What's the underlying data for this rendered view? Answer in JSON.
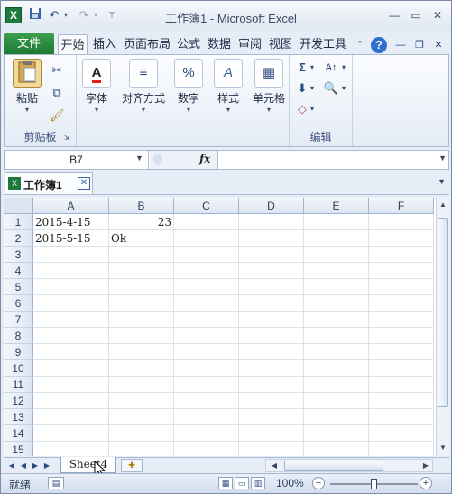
{
  "app": {
    "title": "工作簿1  -  Microsoft Excel",
    "icon_text": "X"
  },
  "qat": {
    "save_icon": "save-icon",
    "undo_icon": "undo-icon",
    "redo_icon": "redo-icon"
  },
  "ribbon_tabs": {
    "file": "文件",
    "items": [
      "开始",
      "插入",
      "页面布局",
      "公式",
      "数据",
      "审阅",
      "视图",
      "开发工具"
    ],
    "active": "开始"
  },
  "ribbon": {
    "paste_label": "粘贴",
    "clipboard_group": "剪贴板",
    "font_label": "字体",
    "align_label": "对齐方式",
    "number_label": "数字",
    "number_symbol": "%",
    "styles_label": "样式",
    "cells_label": "单元格",
    "editing_group": "编辑",
    "sigma_symbol": "Σ"
  },
  "formula_bar": {
    "name_box": "B7",
    "fx": "fx",
    "content": ""
  },
  "workbook_tab": {
    "name": "工作簿1",
    "close": "✕"
  },
  "grid": {
    "columns": [
      "A",
      "B",
      "C",
      "D",
      "E",
      "F"
    ],
    "rows": [
      "1",
      "2",
      "3",
      "4",
      "5",
      "6",
      "7",
      "8",
      "9",
      "10",
      "11",
      "12",
      "13",
      "14",
      "15"
    ],
    "cells": {
      "A1": "2015-4-15",
      "B1": "23",
      "A2": "2015-5-15",
      "B2": "Ok"
    }
  },
  "sheet_tabs": {
    "active": "Sheet4"
  },
  "status": {
    "ready": "就绪",
    "zoom": "100%",
    "zoom_level_percent": 100
  }
}
